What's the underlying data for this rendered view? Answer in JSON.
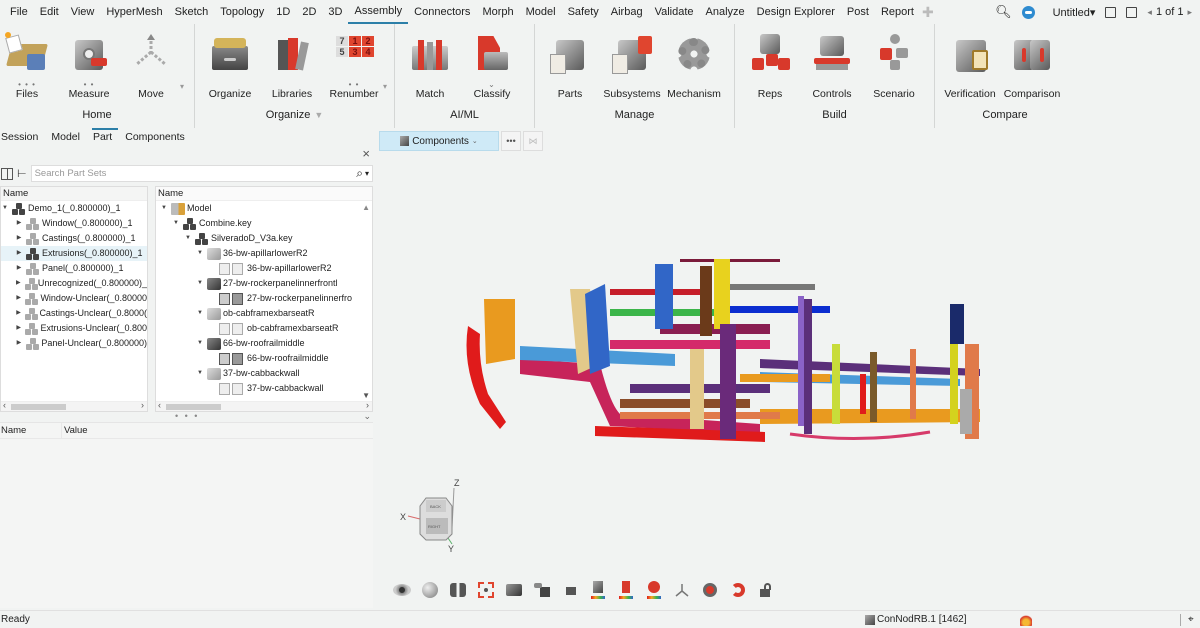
{
  "menubar": {
    "items": [
      "File",
      "Edit",
      "View",
      "HyperMesh",
      "Sketch",
      "Topology",
      "1D",
      "2D",
      "3D",
      "Assembly",
      "Connectors",
      "Morph",
      "Model",
      "Safety",
      "Airbag",
      "Validate",
      "Analyze",
      "Design Explorer",
      "Post",
      "Report"
    ],
    "active": "Assembly",
    "add_icon": "plus-icon",
    "right": {
      "search_icon": "search-icon",
      "chat_icon": "chat-icon",
      "session_name": "Untitled▾",
      "page_prev": "◂",
      "page_label": "1 of 1",
      "page_next": "▸"
    }
  },
  "ribbon": {
    "groups": [
      {
        "label": "Home",
        "has_dropdown": false,
        "tools": [
          {
            "label": "Files",
            "icon": "files-icon",
            "dots": "• • •"
          },
          {
            "label": "Measure",
            "icon": "measure-icon",
            "dots": "• •"
          },
          {
            "label": "Move",
            "icon": "move-icon",
            "caret": "▾"
          }
        ]
      },
      {
        "label": "Organize",
        "has_dropdown": true,
        "tools": [
          {
            "label": "Organize",
            "icon": "organize-icon"
          },
          {
            "label": "Libraries",
            "icon": "libraries-icon"
          },
          {
            "label": "Renumber",
            "icon": "renumber-icon",
            "dots": "• •",
            "caret": "▾"
          }
        ]
      },
      {
        "label": "AI/ML",
        "has_dropdown": false,
        "tools": [
          {
            "label": "Match",
            "icon": "match-icon"
          },
          {
            "label": "Classify",
            "icon": "classify-icon",
            "dots": "⌄"
          }
        ]
      },
      {
        "label": "Manage",
        "has_dropdown": false,
        "tools": [
          {
            "label": "Parts",
            "icon": "parts-icon"
          },
          {
            "label": "Subsystems",
            "icon": "subsystems-icon"
          },
          {
            "label": "Mechanism",
            "icon": "mechanism-icon"
          }
        ]
      },
      {
        "label": "Build",
        "has_dropdown": false,
        "tools": [
          {
            "label": "Reps",
            "icon": "reps-icon"
          },
          {
            "label": "Controls",
            "icon": "controls-icon"
          },
          {
            "label": "Scenario",
            "icon": "scenario-icon"
          }
        ]
      },
      {
        "label": "Compare",
        "has_dropdown": false,
        "tools": [
          {
            "label": "Verification",
            "icon": "verification-icon"
          },
          {
            "label": "Comparison",
            "icon": "comparison-icon"
          }
        ]
      }
    ]
  },
  "panel": {
    "tabs": [
      "Session",
      "Model",
      "Part",
      "Components"
    ],
    "active_tab": "Part",
    "close": "×",
    "search_placeholder": "Search Part Sets",
    "left_tree": {
      "header": "Name",
      "root": "Demo_1(_0.800000)_1",
      "children": [
        "Window(_0.800000)_1",
        "Castings(_0.800000)_1",
        "Extrusions(_0.800000)_1",
        "Panel(_0.800000)_1",
        "Unrecognized(_0.800000)_",
        "Window-Unclear(_0.80000",
        "Castings-Unclear(_0.8000(",
        "Extrusions-Unclear(_0.800",
        "Panel-Unclear(_0.800000)"
      ],
      "selected_index": 2
    },
    "right_tree": {
      "header": "Name",
      "nodes": [
        {
          "label": "Model",
          "level": 0,
          "type": "model"
        },
        {
          "label": "Combine.key",
          "level": 1,
          "type": "group"
        },
        {
          "label": "SilveradoD_V3a.key",
          "level": 2,
          "type": "group"
        },
        {
          "label": "36-bw-apillarlowerR2",
          "level": 3,
          "type": "part"
        },
        {
          "label": "36-bw-apillarlowerR2",
          "level": 4,
          "type": "comp"
        },
        {
          "label": "27-bw-rockerpanelinnerfrontl",
          "level": 3,
          "type": "part-dark"
        },
        {
          "label": "27-bw-rockerpanelinnerfro",
          "level": 4,
          "type": "comp-dark"
        },
        {
          "label": "ob-cabframexbarseatR",
          "level": 3,
          "type": "part"
        },
        {
          "label": "ob-cabframexbarseatR",
          "level": 4,
          "type": "comp"
        },
        {
          "label": "66-bw-roofrailmiddle",
          "level": 3,
          "type": "part-dark"
        },
        {
          "label": "66-bw-roofrailmiddle",
          "level": 4,
          "type": "comp-dark"
        },
        {
          "label": "37-bw-cabbackwall",
          "level": 3,
          "type": "part"
        },
        {
          "label": "37-bw-cabbackwall",
          "level": 4,
          "type": "comp"
        }
      ]
    },
    "props": {
      "col_name": "Name",
      "col_value": "Value"
    }
  },
  "viewport": {
    "entity_selector": "Components",
    "more_label": "•••",
    "triad": {
      "x": "X",
      "y": "Y",
      "z": "Z",
      "top_face": "BACK",
      "front_face": "RIGHT"
    },
    "toolbar_icons": [
      "visualization-eye-icon",
      "globe-icon",
      "binoculars-icon",
      "fit-view-icon",
      "camera-icon",
      "cube-arrow-icon",
      "section-icon",
      "color-by-component-icon",
      "color-by-thickness-icon",
      "color-by-results-icon",
      "axis-triad-icon",
      "zoom-search-icon",
      "magnet-icon",
      "lock-icon"
    ]
  },
  "statusbar": {
    "left": "Ready",
    "current_component": "ConNodRB.1 [1462]"
  }
}
